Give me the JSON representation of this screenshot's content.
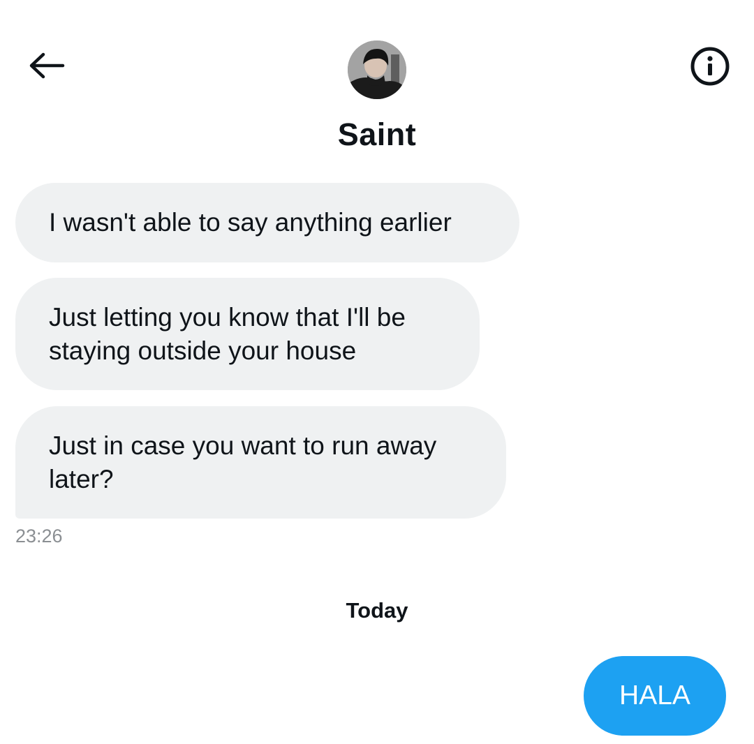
{
  "header": {
    "back_icon": "arrow-left-icon",
    "info_icon": "info-circle-icon",
    "contact_name": "Saint"
  },
  "messages": {
    "received": [
      {
        "text": "I wasn't able to say anything earlier"
      },
      {
        "text": "Just letting you know that I'll be staying outside your house"
      },
      {
        "text": "Just in case you want to run away later?"
      }
    ],
    "received_time": "23:26",
    "divider": "Today",
    "sent": [
      {
        "text": "HALA"
      }
    ]
  },
  "colors": {
    "received_bubble": "#eff1f2",
    "sent_bubble": "#1da1f2",
    "timestamp": "#8b8f93"
  }
}
